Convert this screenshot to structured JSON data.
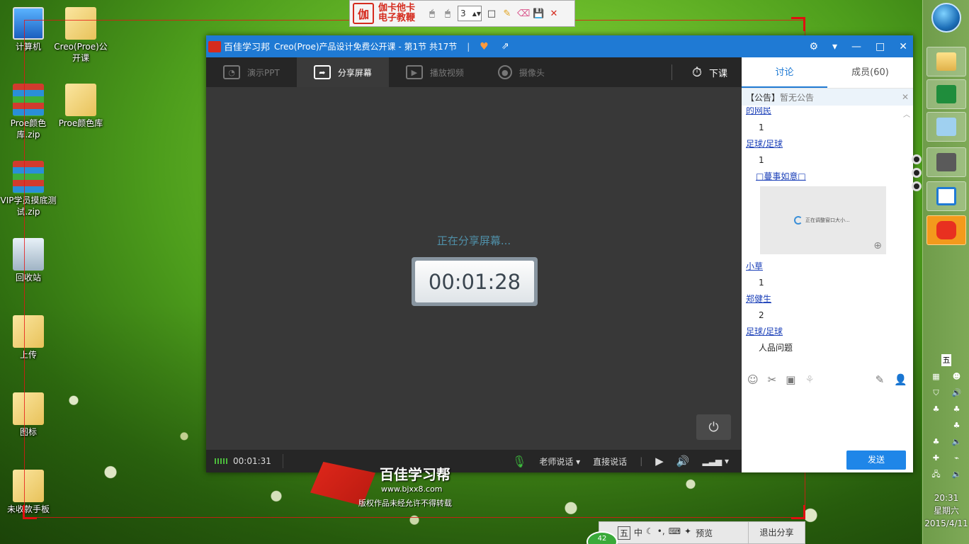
{
  "desktop": {
    "icons": [
      {
        "label": "计算机"
      },
      {
        "label": "Creo(Proe)公开课"
      },
      {
        "label": "Proe颜色库.zip"
      },
      {
        "label": "Proe颜色库"
      },
      {
        "label": "VIP学员摸底测试.zip"
      },
      {
        "label": "回收站"
      },
      {
        "label": "上传"
      },
      {
        "label": "图标"
      },
      {
        "label": "未收款手板"
      }
    ]
  },
  "annotation_toolbar": {
    "logo_char": "伽",
    "title": "伽卡他卡电子教鞭",
    "stroke_width": "3"
  },
  "window": {
    "brand": "百佳学习邦",
    "course_title": "Creo(Proe)产品设计免费公开课 - 第1节 共17节",
    "separator": "|"
  },
  "stage": {
    "tabs": [
      {
        "label": "演示PPT",
        "active": false
      },
      {
        "label": "分享屏幕",
        "active": true
      },
      {
        "label": "播放视频",
        "active": false
      },
      {
        "label": "摄像头",
        "active": false
      }
    ],
    "end_class_label": "下课",
    "sharing_text": "正在分享屏幕...",
    "timer": "00:01:28"
  },
  "bottom_bar": {
    "elapsed": "00:01:31",
    "teacher_mode": "老师说话",
    "direct_talk": "直接说话"
  },
  "side_panel": {
    "tabs": [
      {
        "label": "讨论",
        "active": true
      },
      {
        "label": "成员(60)",
        "active": false
      }
    ],
    "notice_label": "【公告】",
    "notice_text": "暂无公告",
    "messages": [
      {
        "user": "的网民",
        "text": "1"
      },
      {
        "user": "足球/足球",
        "text": "1"
      },
      {
        "user": "□蔓事如意□",
        "image_caption": "正在调整窗口大小..."
      },
      {
        "user": "小草",
        "text": "1"
      },
      {
        "user": "郑健生",
        "text": "2"
      },
      {
        "user": "足球/足球",
        "text": "人品问题"
      }
    ],
    "send_label": "发送"
  },
  "watermark": {
    "title": "百佳学习帮",
    "url": "www.bjxx8.com",
    "note": "版权作品未经允许不得转载"
  },
  "float_bar": {
    "ime_label": "五",
    "ime_mode": "中",
    "preview_label": "预览",
    "exit_label": "退出分享",
    "badge": "42"
  },
  "taskbar": {
    "ime_tray": "五",
    "clock_time": "20:31",
    "clock_day": "星期六",
    "clock_date": "2015/4/11"
  }
}
